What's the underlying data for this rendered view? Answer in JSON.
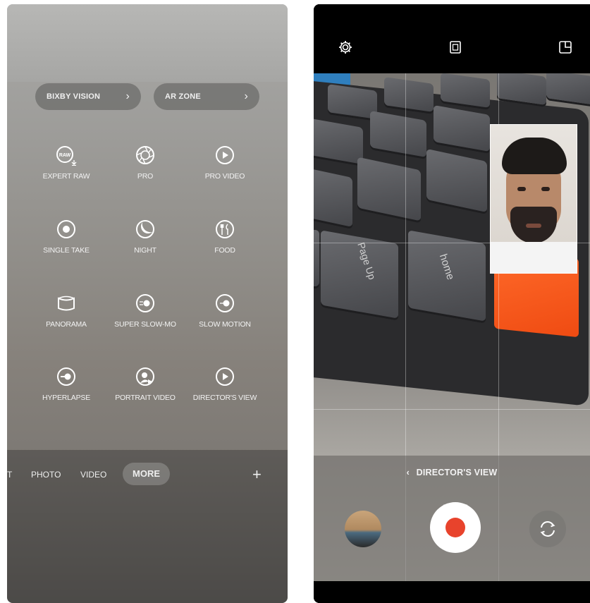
{
  "left_screen": {
    "pills": [
      {
        "label": "BIXBY VISION",
        "chevron": "›"
      },
      {
        "label": "AR ZONE",
        "chevron": "›"
      }
    ],
    "modes": [
      {
        "label": "EXPERT RAW",
        "icon": "raw-icon"
      },
      {
        "label": "PRO",
        "icon": "aperture-icon"
      },
      {
        "label": "PRO VIDEO",
        "icon": "play-circle-icon"
      },
      {
        "label": "SINGLE TAKE",
        "icon": "single-take-icon"
      },
      {
        "label": "NIGHT",
        "icon": "moon-icon"
      },
      {
        "label": "FOOD",
        "icon": "fork-knife-icon"
      },
      {
        "label": "PANORAMA",
        "icon": "panorama-icon"
      },
      {
        "label": "SUPER SLOW-MO",
        "icon": "super-slow-mo-icon"
      },
      {
        "label": "SLOW MOTION",
        "icon": "slow-motion-icon"
      },
      {
        "label": "HYPERLAPSE",
        "icon": "hyperlapse-icon"
      },
      {
        "label": "PORTRAIT VIDEO",
        "icon": "portrait-video-icon"
      },
      {
        "label": "DIRECTOR'S VIEW",
        "icon": "directors-view-icon"
      }
    ],
    "mode_tabs": {
      "partial": "T",
      "photo": "PHOTO",
      "video": "VIDEO",
      "more": "MORE",
      "plus": "+"
    }
  },
  "right_screen": {
    "top_icons": [
      "settings-gear-icon",
      "aspect-ratio-icon",
      "layout-split-icon"
    ],
    "keycap_labels": {
      "page_up": "Page Up",
      "home": "home"
    },
    "mode_label": "DIRECTOR'S VIEW",
    "mode_back_chevron": "‹",
    "record_color": "#e8432c"
  }
}
